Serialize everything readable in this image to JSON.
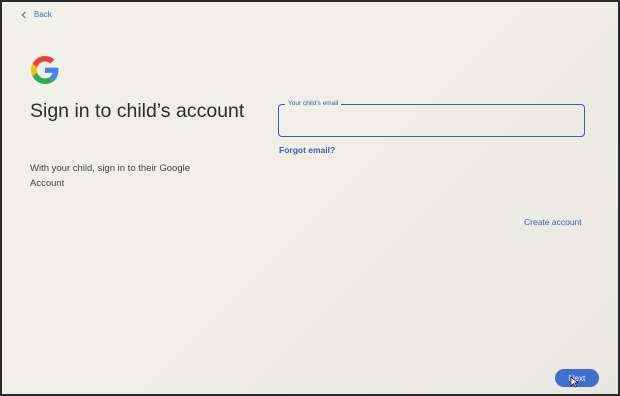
{
  "nav": {
    "back_label": "Back"
  },
  "header": {
    "title": "Sign in to child’s account",
    "subtitle": "With your child, sign in to their Google Account"
  },
  "form": {
    "email_label": "Your child’s email",
    "email_value": "",
    "forgot_label": "Forgot email?"
  },
  "actions": {
    "create_account_label": "Create account",
    "next_label": "Next"
  },
  "colors": {
    "accent": "#3e5ea8",
    "button": "#3f6fd0"
  },
  "icons": {
    "back": "chevron-left-icon",
    "logo": "google-logo-icon",
    "cursor": "mouse-cursor-icon"
  }
}
